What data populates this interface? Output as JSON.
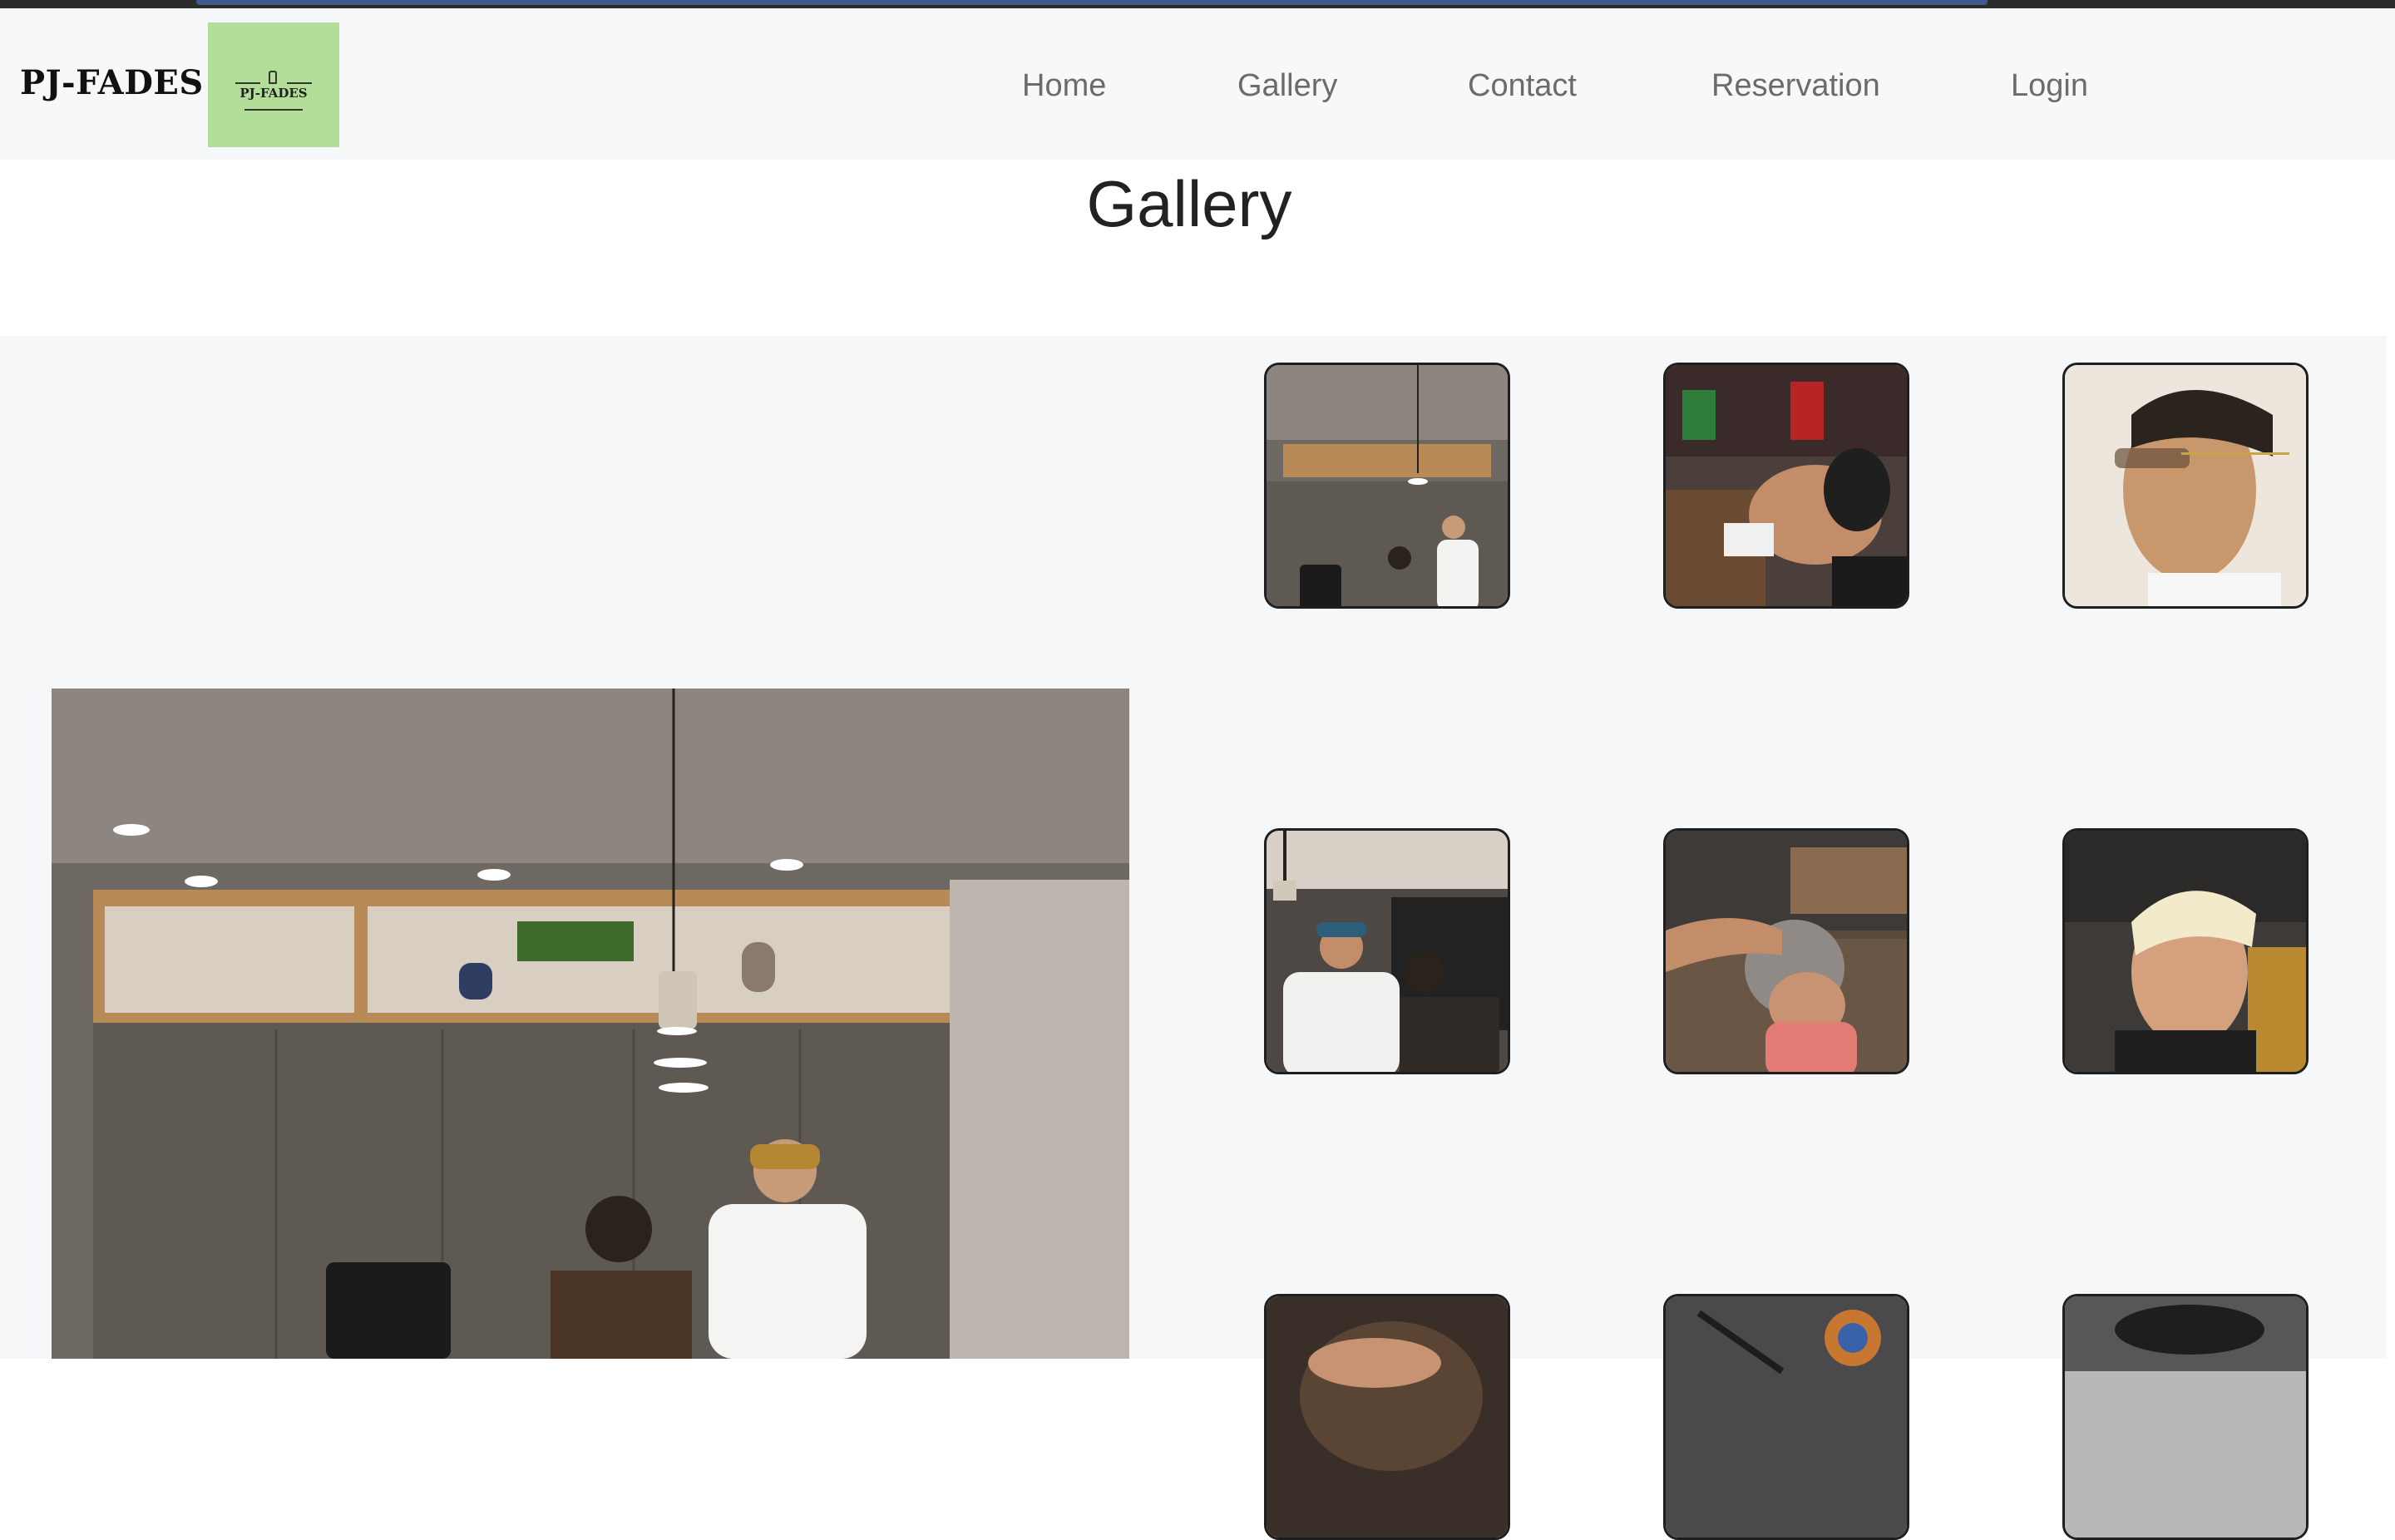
{
  "brand": {
    "name": "PJ-FADES",
    "logo_text": "PJ-FADES"
  },
  "nav": {
    "items": [
      {
        "label": "Home"
      },
      {
        "label": "Gallery"
      },
      {
        "label": "Contact"
      },
      {
        "label": "Reservation"
      },
      {
        "label": "Login"
      }
    ]
  },
  "page": {
    "title": "Gallery"
  },
  "gallery": {
    "feature_image": "barber-cutting-hair-kitchen",
    "thumbnails": [
      {
        "subject": "barber-cutting-hair-kitchen"
      },
      {
        "subject": "client-reclined-fresh-fade"
      },
      {
        "subject": "man-in-sunglasses-profile"
      },
      {
        "subject": "barber-lining-up-beard"
      },
      {
        "subject": "child-skin-fade-comb"
      },
      {
        "subject": "bleached-blonde-crop"
      },
      {
        "subject": "haircut-detail"
      },
      {
        "subject": "barber-tools-closeup"
      },
      {
        "subject": "haircut-in-car"
      }
    ]
  },
  "colors": {
    "header_bg": "#f7f8fa",
    "logo_bg": "#b2de9a",
    "gallery_bg": "#f6f7f9",
    "nav_text": "#6b6b6b",
    "thumb_border": "#1e1e1e"
  }
}
